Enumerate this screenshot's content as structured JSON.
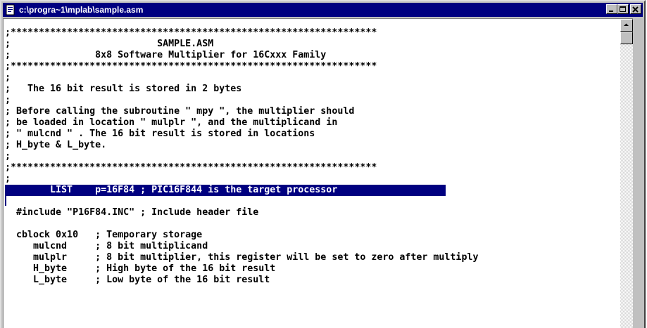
{
  "window": {
    "title": "c:\\progra~1\\mplab\\sample.asm",
    "icon": "document-icon",
    "buttons": [
      "minimize",
      "maximize",
      "close"
    ]
  },
  "editor": {
    "lines": [
      ";*****************************************************************",
      ";                          SAMPLE.ASM",
      ";               8x8 Software Multiplier for 16Cxxx Family",
      ";*****************************************************************",
      ";",
      ";   The 16 bit result is stored in 2 bytes",
      ";",
      "; Before calling the subroutine \" mpy \", the multiplier should",
      "; be loaded in location \" mulplr \", and the multiplicand in",
      "; \" mulcnd \" . The 16 bit result is stored in locations",
      "; H_byte & L_byte.",
      ";",
      ";*****************************************************************",
      ";",
      "        LIST    p=16F84 ; PIC16F844 is the target processor",
      "",
      "  #include \"P16F84.INC\" ; Include header file",
      "",
      "  cblock 0x10   ; Temporary storage",
      "     mulcnd     ; 8 bit multiplicand",
      "     mulplr     ; 8 bit multiplier, this register will be set to zero after multiply",
      "     H_byte     ; High byte of the 16 bit result",
      "     L_byte     ; Low byte of the 16 bit result"
    ],
    "highlighted_line_index": 14
  },
  "colors": {
    "titlebar": "#000080",
    "selection": "#000080",
    "chrome": "#c0c0c0"
  }
}
